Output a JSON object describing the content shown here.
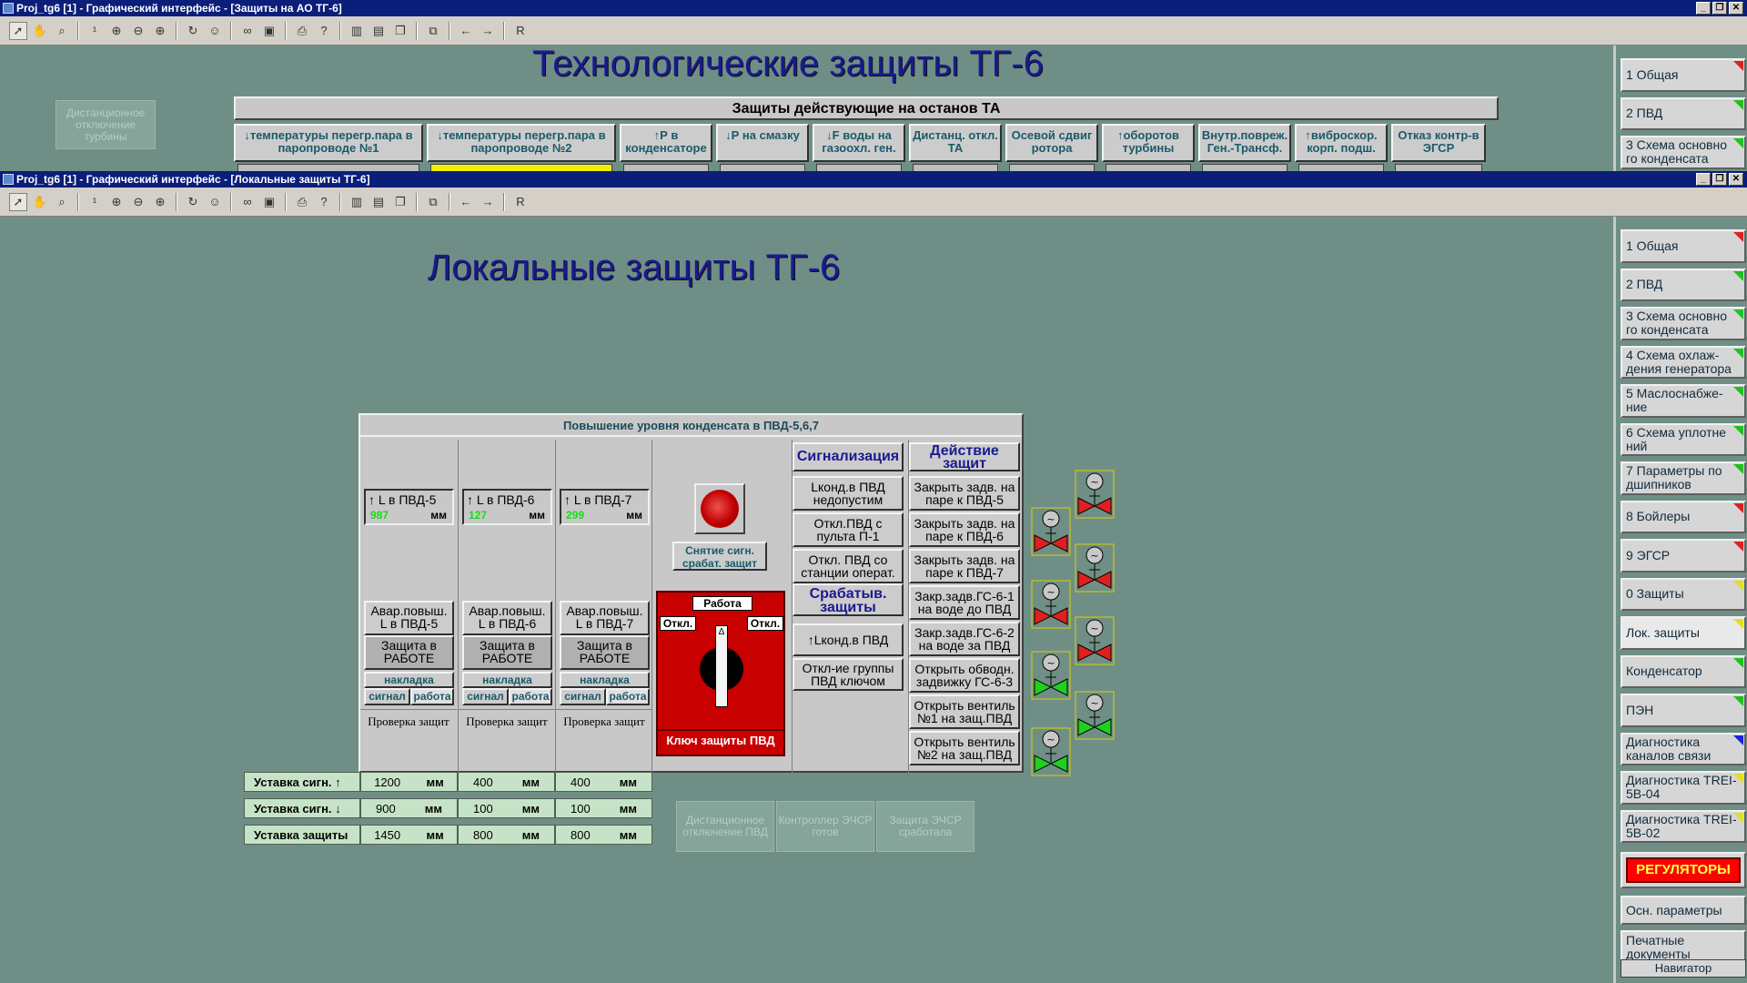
{
  "window_top": {
    "title": "Proj_tg6 [1] - Графический интерфейс - [Защиты на АО ТГ-6]",
    "heading": "Технологические защиты ТГ-6",
    "ghost_button": "Дистанционное отключение турбины",
    "table_title": "Защиты действующие на останов ТА",
    "columns": [
      "↓температуры перегр.пара в паропроводе №1",
      "↓температуры перегр.пара в паропроводе №2",
      "↑Р в конденсаторе",
      "↓Р на смазку",
      "↓F воды на газоохл. ген.",
      "Дистанц. откл. ТА",
      "Осевой сдвиг ротора",
      "↑оборотов турбины",
      "Внутр.повреж. Ген.-Трансф.",
      "↑виброскор. корп. подш.",
      "Отказ контр-в ЭГСР"
    ],
    "nav": [
      {
        "label": "1 Общая",
        "flag": "#e02020"
      },
      {
        "label": "2 ПВД",
        "flag": "#20c020"
      },
      {
        "label": "3 Схема основно го конденсата",
        "flag": "#20c020"
      }
    ]
  },
  "window_main": {
    "title": "Proj_tg6 [1] - Графический интерфейс - [Локальные защиты ТГ-6]",
    "heading": "Локальные защиты ТГ-6",
    "panel_title": "Повышение уровня конденсата в ПВД-5,6,7",
    "channels": [
      {
        "label": "↑ L в ПВД-5",
        "value": "987",
        "unit": "мм",
        "alarm": "Авар.повыш. L в ПВД-5",
        "status": "Защита в РАБОТЕ",
        "overlay": "накладка",
        "sig": "сигнал",
        "work": "работа",
        "check": "Проверка защит"
      },
      {
        "label": "↑ L в ПВД-6",
        "value": "127",
        "unit": "мм",
        "alarm": "Авар.повыш. L в ПВД-6",
        "status": "Защита в РАБОТЕ",
        "overlay": "накладка",
        "sig": "сигнал",
        "work": "работа",
        "check": "Проверка защит"
      },
      {
        "label": "↑ L в ПВД-7",
        "value": "299",
        "unit": "мм",
        "alarm": "Авар.повыш. L в ПВД-7",
        "status": "Защита в РАБОТЕ",
        "overlay": "накладка",
        "sig": "сигнал",
        "work": "работа",
        "check": "Проверка защит"
      }
    ],
    "reset_button": "Снятие сигн. срабат. защит",
    "key": {
      "work": "Работа",
      "off_left": "Откл.",
      "off_right": "Откл.",
      "caption": "Ключ защиты ПВД"
    },
    "signal_header": "Сигнализация",
    "signals": [
      "Lконд.в ПВД недопустим",
      "Откл.ПВД с пульта П-1",
      "Откл. ПВД со станции операт."
    ],
    "tripped_header": "Срабатыв. защиты",
    "tripped": [
      "↑Lконд.в ПВД",
      "Откл-ие группы ПВД ключом"
    ],
    "action_header": "Действие защит",
    "actions": [
      "Закрыть задв. на паре к ПВД-5",
      "Закрыть задв. на паре к ПВД-6",
      "Закрыть задв. на паре к ПВД-7",
      "Закр.задв.ГС-6-1 на воде до ПВД",
      "Закр.задв.ГС-6-2 на воде за ПВД",
      "Открыть обводн. задвижку ГС-6-3",
      "Открыть вентиль №1 на защ.ПВД",
      "Открыть вентиль №2 на защ.ПВД"
    ],
    "setpoints": [
      {
        "label": "Уставка сигн. ↑",
        "values": [
          "1200",
          "400",
          "400"
        ],
        "unit": "мм"
      },
      {
        "label": "Уставка сигн. ↓",
        "values": [
          "900",
          "100",
          "100"
        ],
        "unit": "мм"
      },
      {
        "label": "Уставка защиты",
        "values": [
          "1450",
          "800",
          "800"
        ],
        "unit": "мм"
      }
    ],
    "ghost_buttons": [
      "Дистанционное отключение ПВД",
      "Контроллер ЭЧСР готов",
      "Защита ЭЧСР сработала"
    ],
    "valve_colors": {
      "closed": "#e02020",
      "open": "#20d020"
    },
    "nav": [
      {
        "label": "1 Общая",
        "flag": "#e02020"
      },
      {
        "label": "2 ПВД",
        "flag": "#20c020"
      },
      {
        "label": "3 Схема основно го конденсата",
        "flag": "#20c020"
      },
      {
        "label": "4 Схема охлаж- дения генератора",
        "flag": "#20c020"
      },
      {
        "label": "5 Маслоснабже- ние",
        "flag": "#20c020"
      },
      {
        "label": "6 Схема уплотне ний",
        "flag": "#20c020"
      },
      {
        "label": "7 Параметры по дшипников",
        "flag": "#20c020"
      },
      {
        "label": "8 Бойлеры",
        "flag": "#e02020"
      },
      {
        "label": "9 ЭГСР",
        "flag": "#e02020"
      },
      {
        "label": "0 Защиты",
        "flag": "#e0e020"
      },
      {
        "label": "Лок. защиты",
        "flag": "#e0e020"
      },
      {
        "label": "Конденсатор",
        "flag": "#20c020"
      },
      {
        "label": "ПЭН",
        "flag": "#20c020"
      },
      {
        "label": "Диагностика каналов связи",
        "flag": "#2020e0"
      },
      {
        "label": "Диагностика TREI-5B-04",
        "flag": "#e0e020"
      },
      {
        "label": "Диагностика TREI-5B-02",
        "flag": "#e0e020"
      }
    ],
    "regulators": "РЕГУЛЯТОРЫ",
    "nav_extra": [
      "Осн. параметры",
      "Печатные документы"
    ],
    "navigator": "Навигатор"
  }
}
